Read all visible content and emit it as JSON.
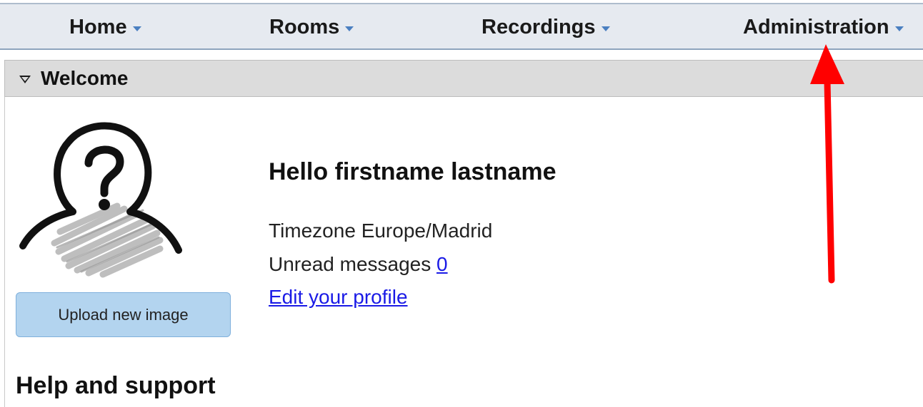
{
  "nav": {
    "items": [
      {
        "label": "Home"
      },
      {
        "label": "Rooms"
      },
      {
        "label": "Recordings"
      },
      {
        "label": "Administration"
      }
    ],
    "caret_color": "#4a7fc0"
  },
  "welcome_panel": {
    "title": "Welcome",
    "toggle_icon": "triangle-down-icon"
  },
  "profile": {
    "avatar_icon": "unknown-user-avatar-icon",
    "upload_label": "Upload new image",
    "greeting": "Hello firstname lastname",
    "timezone_label": "Timezone",
    "timezone_value": "Europe/Madrid",
    "unread_label": "Unread messages",
    "unread_count": "0",
    "edit_profile_link": "Edit your profile"
  },
  "help": {
    "heading": "Help and support"
  },
  "annotation": {
    "arrow_color": "#ff0000",
    "arrow_icon": "red-arrow-up-icon"
  }
}
